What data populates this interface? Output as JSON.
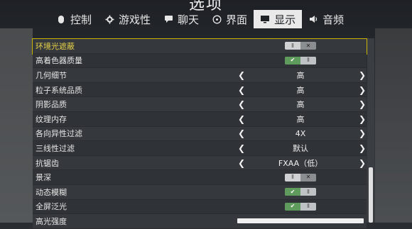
{
  "title": "选项",
  "tabs": [
    {
      "label": "控制",
      "icon": "mouse-icon"
    },
    {
      "label": "游戏性",
      "icon": "gear-icon"
    },
    {
      "label": "聊天",
      "icon": "chat-bubble-icon"
    },
    {
      "label": "界面",
      "icon": "interface-icon"
    },
    {
      "label": "显示",
      "icon": "monitor-icon",
      "active": true
    },
    {
      "label": "音频",
      "icon": "speaker-icon"
    }
  ],
  "settings": [
    {
      "label": "环境光遮蔽",
      "type": "toggle",
      "state": "off"
    },
    {
      "label": "高着色器质量",
      "type": "toggle",
      "state": "on"
    },
    {
      "label": "几何细节",
      "type": "select",
      "value": "高"
    },
    {
      "label": "粒子系统品质",
      "type": "select",
      "value": "高"
    },
    {
      "label": "阴影品质",
      "type": "select",
      "value": "高"
    },
    {
      "label": "纹理内存",
      "type": "select",
      "value": "高"
    },
    {
      "label": "各向异性过滤",
      "type": "select",
      "value": "4X"
    },
    {
      "label": "三线性过滤",
      "type": "select",
      "value": "默认"
    },
    {
      "label": "抗锯齿",
      "type": "select",
      "value": "FXAA（低）"
    },
    {
      "label": "景深",
      "type": "toggle",
      "state": "off"
    },
    {
      "label": "动态模糊",
      "type": "toggle",
      "state": "on"
    },
    {
      "label": "全屏泛光",
      "type": "toggle",
      "state": "on"
    },
    {
      "label": "高光强度",
      "type": "slider",
      "level": 1.0
    }
  ],
  "colors": {
    "highlight": "#e8d24a",
    "toggle_on": "#5f9b5d"
  }
}
